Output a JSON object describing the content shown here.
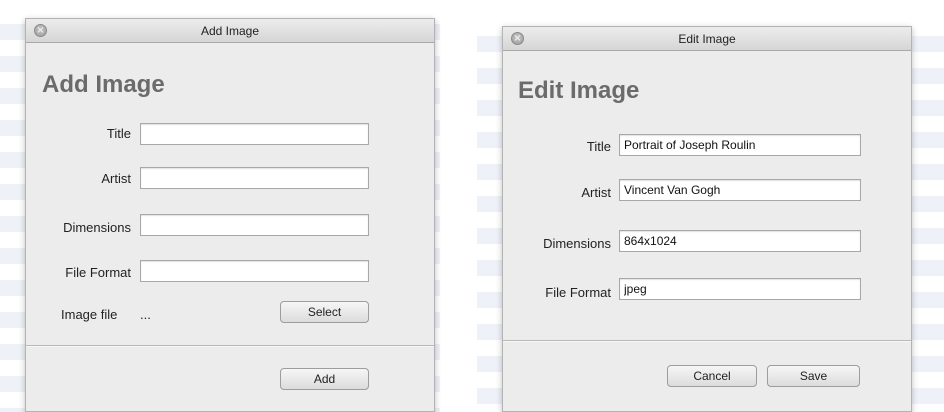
{
  "add_dialog": {
    "window_title": "Add Image",
    "heading": "Add Image",
    "fields": [
      {
        "label": "Title",
        "value": ""
      },
      {
        "label": "Artist",
        "value": ""
      },
      {
        "label": "Dimensions",
        "value": ""
      },
      {
        "label": "File Format",
        "value": ""
      }
    ],
    "image_file_label": "Image file",
    "image_file_value": "...",
    "select_label": "Select",
    "add_label": "Add"
  },
  "edit_dialog": {
    "window_title": "Edit Image",
    "heading": "Edit Image",
    "fields": [
      {
        "label": "Title",
        "value": "Portrait of Joseph Roulin"
      },
      {
        "label": "Artist",
        "value": "Vincent Van Gogh"
      },
      {
        "label": "Dimensions",
        "value": "864x1024"
      },
      {
        "label": "File Format",
        "value": "jpeg"
      }
    ],
    "cancel_label": "Cancel",
    "save_label": "Save"
  },
  "icons": {
    "close": "close-icon"
  }
}
